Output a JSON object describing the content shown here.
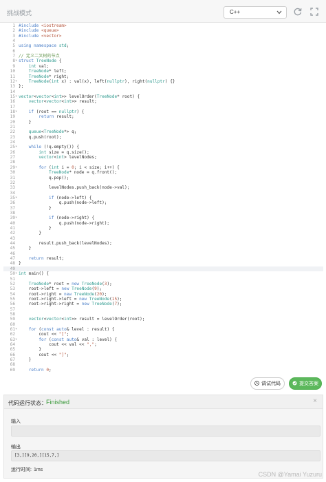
{
  "topbar": {
    "mode_label": "挑战模式",
    "language": "C++"
  },
  "editor": {
    "active_line": 49,
    "lines": [
      "#include <iostream>",
      "#include <queue>",
      "#include <vector>",
      "",
      "using namespace std;",
      "",
      "// 定义二叉树的节点",
      "struct TreeNode {",
      "    int val;",
      "    TreeNode* left;",
      "    TreeNode* right;",
      "    TreeNode(int x) : val(x), left(nullptr), right(nullptr) {}",
      "};",
      "",
      "vector<vector<int>> levelOrder(TreeNode* root) {",
      "    vector<vector<int>> result;",
      "",
      "    if (root == nullptr) {",
      "        return result;",
      "    }",
      "",
      "    queue<TreeNode*> q;",
      "    q.push(root);",
      "",
      "    while (!q.empty()) {",
      "        int size = q.size();",
      "        vector<int> levelNodes;",
      "",
      "        for (int i = 0; i < size; i++) {",
      "            TreeNode* node = q.front();",
      "            q.pop();",
      "",
      "            levelNodes.push_back(node->val);",
      "",
      "            if (node->left) {",
      "                q.push(node->left);",
      "            }",
      "",
      "            if (node->right) {",
      "                q.push(node->right);",
      "            }",
      "        }",
      "",
      "        result.push_back(levelNodes);",
      "    }",
      "",
      "    return result;",
      "}",
      "",
      "int main() {",
      "",
      "    TreeNode* root = new TreeNode(3);",
      "    root->left = new TreeNode(9);",
      "    root->right = new TreeNode(20);",
      "    root->right->left = new TreeNode(15);",
      "    root->right->right = new TreeNode(7);",
      "",
      "",
      "    vector<vector<int>> result = levelOrder(root);",
      "",
      "    for (const auto& level : result) {",
      "        cout << \"[\";",
      "        for (const auto& val : level) {",
      "            cout << val << \",\";",
      "        }",
      "        cout << \"]\";",
      "    }",
      "",
      "    return 0;",
      "}"
    ],
    "fold_lines": [
      8,
      12,
      15,
      18,
      25,
      29,
      35,
      39,
      50,
      61,
      63
    ]
  },
  "buttons": {
    "debug": "调试代码",
    "submit": "提交答案"
  },
  "result_panel": {
    "status_label": "代码运行状态：",
    "status_value": "Finished",
    "close_glyph": "×",
    "input_label": "输入",
    "input_value": "",
    "output_label": "输出",
    "output_value": "[3,][9,20,][15,7,]",
    "runtime_label": "运行时间:",
    "runtime_value": "1ms"
  },
  "watermark": "CSDN @Yamai Yuzuru",
  "colors": {
    "keyword": "#4a7ec7",
    "type": "#2f9a8f",
    "string": "#b5543b",
    "comment": "#6a9955",
    "number": "#b5543b",
    "success": "#3c9a3c",
    "submit_bg": "#5cb85c"
  }
}
